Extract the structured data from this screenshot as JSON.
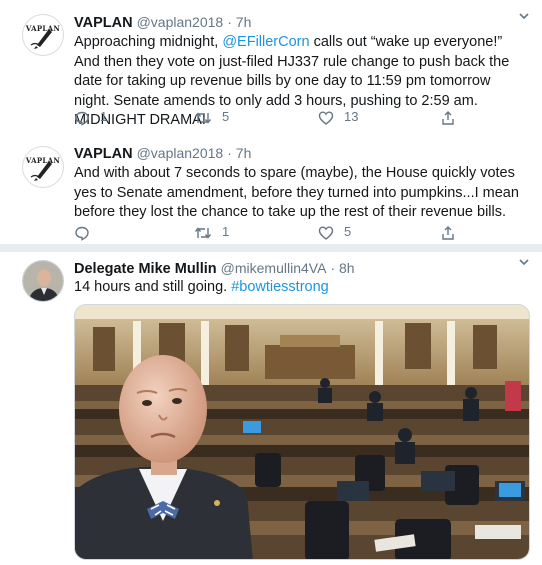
{
  "tweets": [
    {
      "name": "VAPLAN",
      "handle": "@vaplan2018",
      "time": "· 7h",
      "avatar_text": "VAPLAN",
      "text_1": "Approaching midnight, ",
      "mention": "@EFillerCorn",
      "text_2": " calls out “wake up everyone!” And then they vote on just-filed HJ337 rule change to push back the date for taking up revenue bills by one day to 11:59 pm tomorrow night. Senate amends to only add 3 hours, pushing to 2:59 am. MIDNIGHT DRAMA!",
      "replies": "1",
      "retweets": "5",
      "likes": "13"
    },
    {
      "name": "VAPLAN",
      "handle": "@vaplan2018",
      "time": "· 7h",
      "avatar_text": "VAPLAN",
      "text": "And with about 7 seconds to spare (maybe), the House quickly votes yes to Senate amendment, before they turned into pumpkins...I mean before they lost the chance to take up the rest of their revenue bills.",
      "replies": "",
      "retweets": "1",
      "likes": "5"
    },
    {
      "name": "Delegate Mike Mullin",
      "handle": "@mikemullin4VA",
      "time": "· 8h",
      "text": "14 hours and still going. ",
      "hashtag": "#bowtiesstrong"
    }
  ],
  "icons": {
    "reply": "reply-icon",
    "retweet": "retweet-icon",
    "like": "heart-icon",
    "share": "share-icon",
    "caret": "chevron-down-icon"
  },
  "colors": {
    "link": "#1b95e0",
    "secondary": "#657786",
    "divider": "#e6ecf0"
  }
}
